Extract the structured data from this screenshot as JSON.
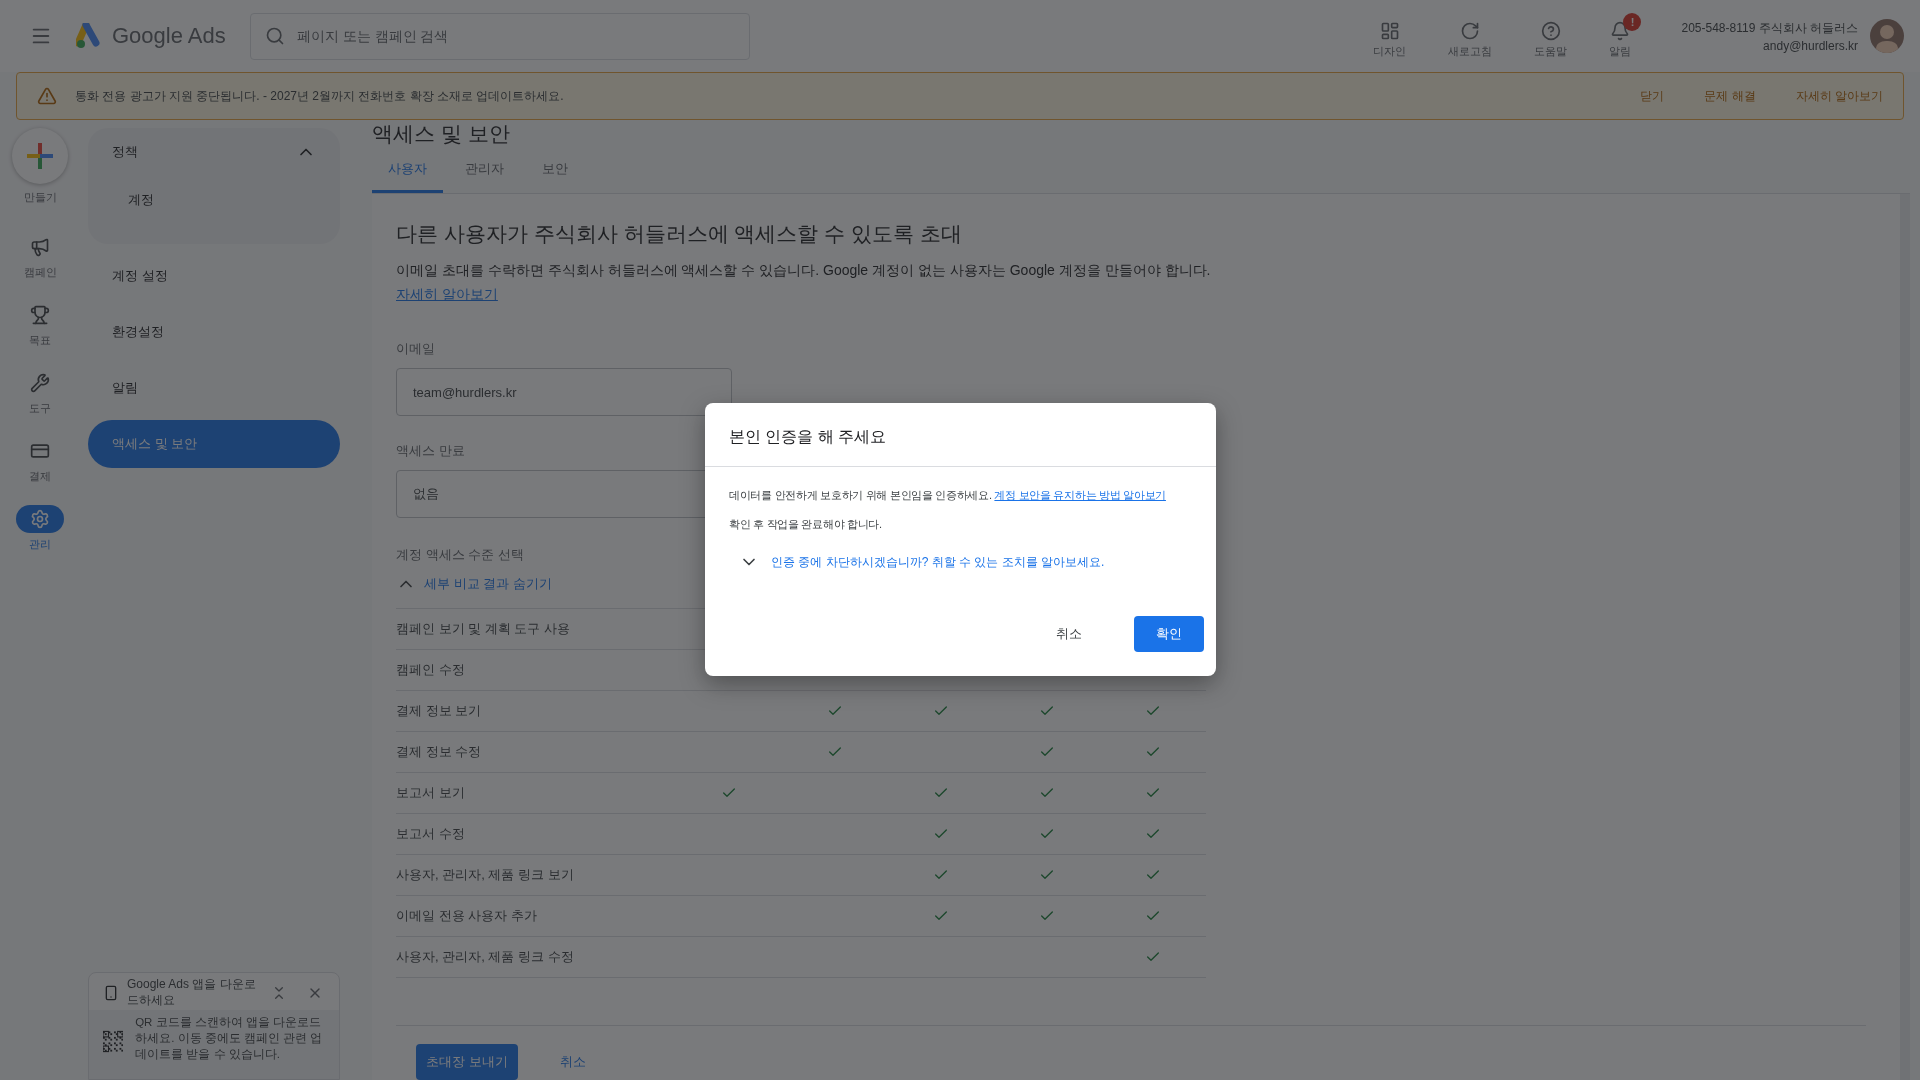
{
  "top_bar": {
    "product": "Google Ads",
    "search": {
      "placeholder": "페이지 또는 캠페인 검색"
    },
    "actions": [
      {
        "label": "디자인"
      },
      {
        "label": "새로고침"
      },
      {
        "label": "도움말"
      },
      {
        "label": "알림",
        "badge": "!"
      }
    ],
    "account": {
      "line_1": "205-548-8119 주식회사 허들러스",
      "line_2": "andy@hurdlers.kr"
    }
  },
  "banner": {
    "message": "통화 전용 광고가 지원 중단됩니다. - 2027년 2월까지 전화번호 확장 소재로 업데이트하세요.",
    "actions": [
      "닫기",
      "문제 해결",
      "자세히 알아보기"
    ]
  },
  "rail": {
    "create": "만들기",
    "items": [
      {
        "label": "캠페인",
        "selected": false
      },
      {
        "label": "목표",
        "selected": false
      },
      {
        "label": "도구",
        "selected": false
      },
      {
        "label": "결제",
        "selected": false
      },
      {
        "label": "관리",
        "selected": true
      }
    ]
  },
  "nav": {
    "group": {
      "title": "정책",
      "expanded": true,
      "children": [
        {
          "label": "계정"
        }
      ]
    },
    "items": [
      {
        "label": "계정 설정",
        "selected": false
      },
      {
        "label": "환경설정",
        "selected": false
      },
      {
        "label": "알림",
        "selected": false
      },
      {
        "label": "액세스 및 보안",
        "selected": true
      }
    ]
  },
  "app_promo": {
    "title": "Google Ads 앱을 다운로드하세요",
    "body": "QR 코드를 스캔하여 앱을 다운로드하세요. 이동 중에도 캠페인 관련 업데이트를 받을 수 있습니다."
  },
  "page": {
    "title": "액세스 및 보안",
    "tabs": [
      {
        "label": "사용자",
        "selected": true
      },
      {
        "label": "관리자",
        "selected": false
      },
      {
        "label": "보안",
        "selected": false
      }
    ],
    "heading": "다른 사용자가 주식회사 허들러스에 액세스할 수 있도록 초대",
    "description": "이메일 초대를 수락하면 주식회사 허들러스에 액세스할 수 있습니다. Google 계정이 없는 사용자는 Google 계정을 만들어야 합니다.",
    "learn_more": "자세히 알아보기",
    "email": {
      "label": "이메일",
      "value": "team@hurdlers.kr"
    },
    "expiry": {
      "label": "액세스 만료",
      "value": "없음"
    },
    "access_level": {
      "label": "계정 액세스 수준 선택",
      "toggle": "세부 비교 결과 숨기기",
      "expanded": true
    },
    "permissions": [
      {
        "label": "캠페인 보기 및 계획 도구 사용"
      },
      {
        "label": "캠페인 수정"
      },
      {
        "label": "결제 정보 보기",
        "checks": [
          false,
          true,
          true,
          true,
          true
        ]
      },
      {
        "label": "결제 정보 수정",
        "checks": [
          false,
          true,
          false,
          true,
          true
        ]
      },
      {
        "label": "보고서 보기",
        "checks": [
          true,
          false,
          true,
          true,
          true
        ]
      },
      {
        "label": "보고서 수정",
        "checks": [
          false,
          false,
          true,
          true,
          true
        ]
      },
      {
        "label": "사용자, 관리자, 제품 링크 보기",
        "checks": [
          false,
          false,
          true,
          true,
          true
        ]
      },
      {
        "label": "이메일 전용 사용자 추가",
        "checks": [
          false,
          false,
          true,
          true,
          true
        ]
      },
      {
        "label": "사용자, 관리자, 제품 링크 수정",
        "checks": [
          false,
          false,
          false,
          false,
          true
        ]
      }
    ],
    "buttons": {
      "primary": "초대장 보내기",
      "secondary": "취소"
    }
  },
  "dialog": {
    "title": "본인 인증을 해 주세요",
    "text": "데이터를 안전하게 보호하기 위해 본인임을 인증하세요.",
    "link": "계정 보안을 유지하는 방법 알아보기",
    "note": "확인 후 작업을 완료해야 합니다.",
    "help": {
      "label": "인증 중에 차단하시겠습니까? 취할 수 있는 조치를 알아보세요.",
      "expanded": false
    },
    "cancel": "취소",
    "confirm": "확인"
  }
}
